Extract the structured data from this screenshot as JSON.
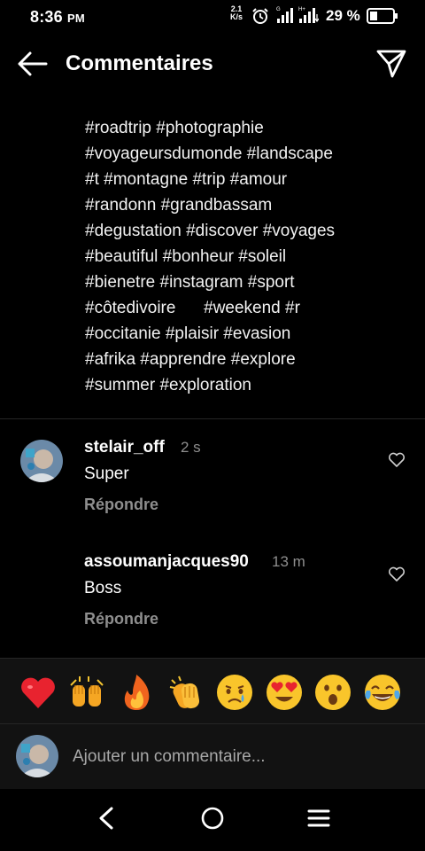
{
  "status_bar": {
    "time": "8:36",
    "ampm": "PM",
    "net_speed_value": "2.1",
    "net_speed_unit": "K/s",
    "battery_percent": "29 %"
  },
  "header": {
    "title": "Commentaires"
  },
  "caption": {
    "lines": [
      "#roadtrip #photographie",
      "#voyageursdumonde #landscape",
      "#t #montagne #trip #amour",
      "#randonn #grandbassam",
      "#degustation #discover #voyages",
      "#beautiful #bonheur #soleil",
      "#bienetre #instagram #sport",
      "#côtedivoire      #weekend #r",
      "#occitanie #plaisir #evasion",
      "#afrika #apprendre #explore",
      "#summer #exploration"
    ]
  },
  "comments": [
    {
      "username": "stelair_off",
      "time": "2 s",
      "text": "Super",
      "reply_label": "Répondre"
    },
    {
      "username": "assoumanjacques90",
      "time": "13 m",
      "text": "Boss",
      "reply_label": "Répondre"
    }
  ],
  "emoji_bar": {
    "items": [
      "red-heart",
      "raising-hands",
      "fire",
      "clapping-hands",
      "crying-face",
      "heart-eyes",
      "surprised-face",
      "tears-of-joy"
    ]
  },
  "input": {
    "placeholder": "Ajouter un commentaire..."
  },
  "colors": {
    "background": "#000000",
    "secondary_text": "#8e8e8e",
    "bar_background": "#121212"
  }
}
